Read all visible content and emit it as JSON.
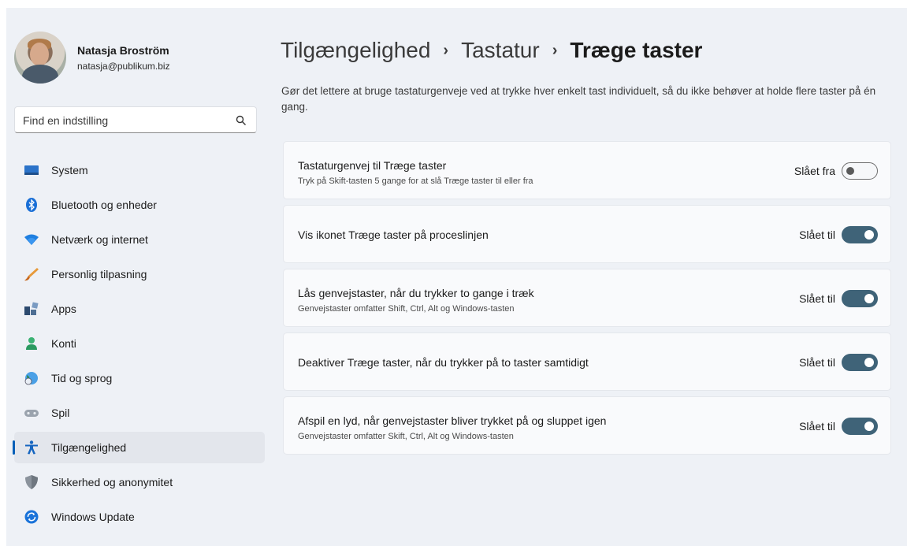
{
  "profile": {
    "name": "Natasja Broström",
    "email": "natasja@publikum.biz"
  },
  "search": {
    "placeholder": "Find en indstilling",
    "icon": "search-icon"
  },
  "sidebar": {
    "items": [
      {
        "label": "System",
        "icon": "system-icon"
      },
      {
        "label": "Bluetooth og enheder",
        "icon": "bluetooth-icon"
      },
      {
        "label": "Netværk og internet",
        "icon": "wifi-icon"
      },
      {
        "label": "Personlig tilpasning",
        "icon": "brush-icon"
      },
      {
        "label": "Apps",
        "icon": "apps-icon"
      },
      {
        "label": "Konti",
        "icon": "account-icon"
      },
      {
        "label": "Tid og sprog",
        "icon": "globe-clock-icon"
      },
      {
        "label": "Spil",
        "icon": "gamepad-icon"
      },
      {
        "label": "Tilgængelighed",
        "icon": "accessibility-icon",
        "active": true
      },
      {
        "label": "Sikkerhed og anonymitet",
        "icon": "shield-icon"
      },
      {
        "label": "Windows Update",
        "icon": "update-icon"
      }
    ]
  },
  "breadcrumb": {
    "items": [
      "Tilgængelighed",
      "Tastatur",
      "Træge taster"
    ],
    "separator": "›"
  },
  "description": "Gør det lettere at bruge tastaturgenveje ved at trykke hver enkelt tast individuelt, så du ikke behøver at holde flere taster på én gang.",
  "settings": [
    {
      "title": "Tastaturgenvej til Træge taster",
      "subtitle": "Tryk på Skift-tasten 5 gange for at slå Træge taster til eller fra",
      "state": "Slået fra",
      "on": false
    },
    {
      "title": "Vis ikonet Træge taster på proceslinjen",
      "subtitle": "",
      "state": "Slået til",
      "on": true
    },
    {
      "title": "Lås genvejstaster, når du trykker to gange i træk",
      "subtitle": "Genvejstaster omfatter Shift, Ctrl, Alt og Windows-tasten",
      "state": "Slået til",
      "on": true
    },
    {
      "title": "Deaktiver Træge taster, når du trykker på to taster samtidigt",
      "subtitle": "",
      "state": "Slået til",
      "on": true
    },
    {
      "title": "Afspil en lyd, når genvejstaster bliver trykket på og sluppet igen",
      "subtitle": "Genvejstaster omfatter Skift, Ctrl, Alt og Windows-tasten",
      "state": "Slået til",
      "on": true
    }
  ],
  "colors": {
    "accent": "#005fb8",
    "toggle_on": "#3f6378",
    "background": "#eef1f6"
  }
}
